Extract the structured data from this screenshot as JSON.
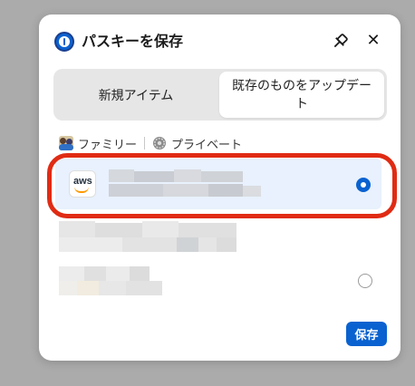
{
  "dialog": {
    "title": "パスキーを保存",
    "logo_icon": "1password-logo-icon",
    "pin_icon": "pin-icon",
    "close_icon": "close-icon",
    "close_glyph": "✕"
  },
  "tabs": {
    "new_item": "新規アイテム",
    "update_existing": "既存のものをアップデート",
    "selected": "update_existing"
  },
  "vaults": [
    {
      "icon": "family-vault-icon",
      "label": "ファミリー"
    },
    {
      "icon": "gear-icon",
      "label": "プライベート"
    }
  ],
  "items": [
    {
      "icon": "aws-icon",
      "icon_text": "aws",
      "title": "",
      "subtitle": "",
      "selected": true
    },
    {
      "icon": "",
      "title": "",
      "subtitle": "",
      "selected": false
    },
    {
      "icon": "",
      "title": "",
      "subtitle": "",
      "selected": false
    }
  ],
  "save_button": "保存",
  "colors": {
    "accent": "#0a62d0",
    "selected_row": "#e8f1fd",
    "annotation_ring": "#e02b14",
    "background": "#ababab"
  }
}
